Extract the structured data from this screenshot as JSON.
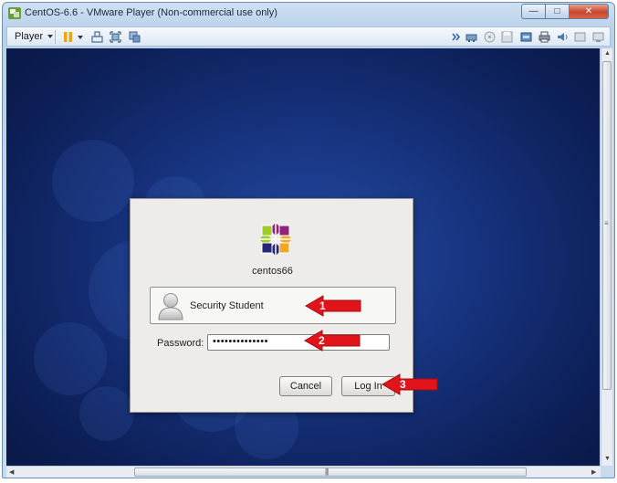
{
  "window": {
    "title": "CentOS-6.6 - VMware Player (Non-commercial use only)"
  },
  "toolbar": {
    "player_menu_label": "Player"
  },
  "login_dialog": {
    "hostname": "centos66",
    "user_name": "Security Student",
    "password_label": "Password:",
    "password_value": "••••••••••••••",
    "cancel_label": "Cancel",
    "login_label": "Log In"
  },
  "annotations": [
    {
      "label": "1",
      "target": "user-row"
    },
    {
      "label": "2",
      "target": "password-field"
    },
    {
      "label": "3",
      "target": "login-button"
    }
  ],
  "colors": {
    "annotation_arrow": "#e0141a",
    "desktop_blue": "#17337e",
    "dialog_bg": "#edecea",
    "titlebar": "#c7daee"
  },
  "icons": {
    "app": "vmware-player-icon",
    "logo": "centos-logo-icon",
    "avatar": "user-avatar-icon"
  }
}
